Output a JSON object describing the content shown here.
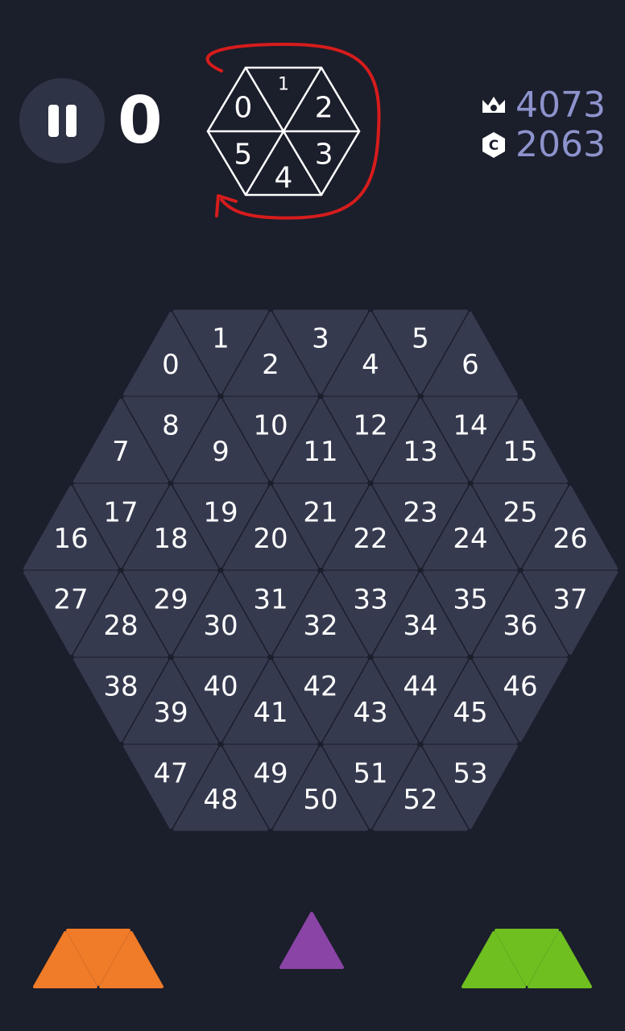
{
  "hud": {
    "score": "0",
    "best_score": "4073",
    "coins": "2063"
  },
  "sketch": {
    "labels": [
      "0",
      "1",
      "2",
      "3",
      "4",
      "5"
    ]
  },
  "board": {
    "rows": [
      {
        "labels": [
          "0",
          "1",
          "2",
          "3",
          "4",
          "5",
          "6"
        ]
      },
      {
        "labels": [
          "7",
          "8",
          "9",
          "10",
          "11",
          "12",
          "13",
          "14",
          "15"
        ]
      },
      {
        "labels": [
          "16",
          "17",
          "18",
          "19",
          "20",
          "21",
          "22",
          "23",
          "24",
          "25",
          "26"
        ]
      },
      {
        "labels": [
          "27",
          "28",
          "29",
          "30",
          "31",
          "32",
          "33",
          "34",
          "35",
          "36",
          "37"
        ]
      },
      {
        "labels": [
          "38",
          "39",
          "40",
          "41",
          "42",
          "43",
          "44",
          "45",
          "46"
        ]
      },
      {
        "labels": [
          "47",
          "48",
          "49",
          "50",
          "51",
          "52",
          "53"
        ]
      }
    ]
  },
  "pieces": [
    {
      "name": "orange-trapezoid-piece",
      "color": "#f07b28"
    },
    {
      "name": "purple-triangle-piece",
      "color": "#8a44a6"
    },
    {
      "name": "green-trapezoid-piece",
      "color": "#6fbf20"
    }
  ],
  "colors": {
    "background": "#1b1e2b",
    "cell": "#353a4f",
    "sketch_arrow": "#d61c1c",
    "stat_text": "#8d93cc"
  }
}
